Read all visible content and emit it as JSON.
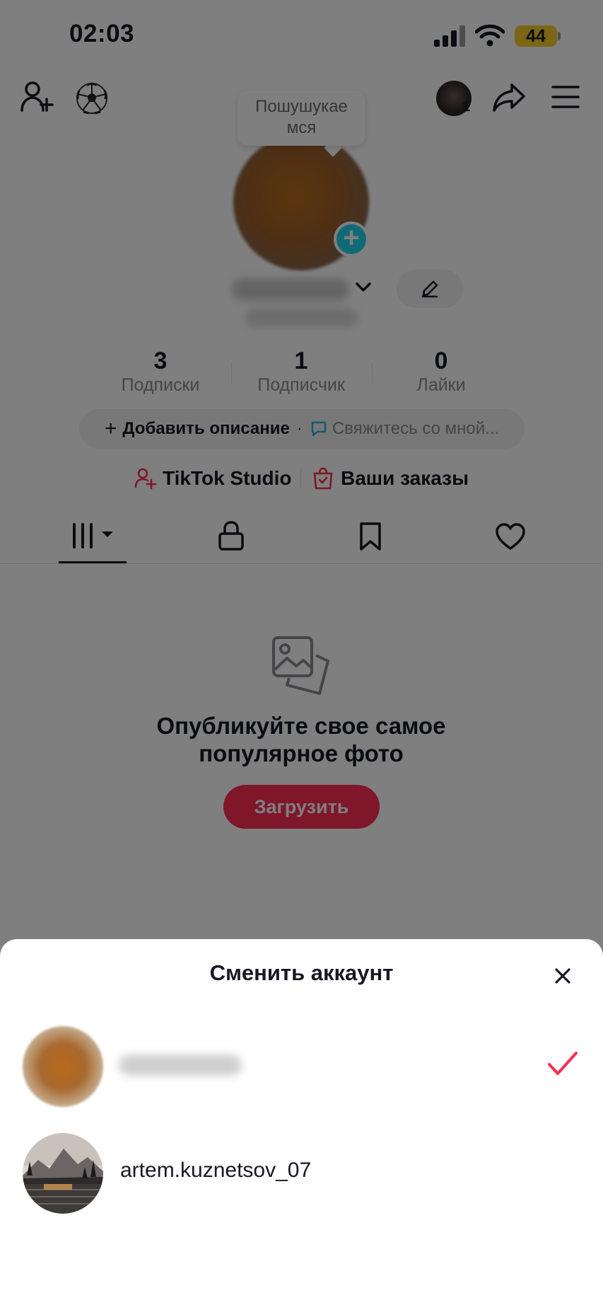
{
  "status_bar": {
    "time": "02:03",
    "battery": "44"
  },
  "header": {
    "avatar_badge": "1"
  },
  "profile": {
    "tooltip": "Пошушукаем ся",
    "tooltip_line1": "Пошушукае",
    "tooltip_line2": "мся",
    "stats": [
      {
        "value": "3",
        "label": "Подписки"
      },
      {
        "value": "1",
        "label": "Подписчик"
      },
      {
        "value": "0",
        "label": "Лайки"
      }
    ],
    "add_description": "Добавить описание",
    "bio_separator": "·",
    "contact_me": "Свяжитесь со мной...",
    "studio_label": "TikTok Studio",
    "orders_label": "Ваши заказы"
  },
  "empty_state": {
    "title_line1": "Опубликуйте свое самое",
    "title_line2": "популярное фото",
    "upload_button": "Загрузить"
  },
  "sheet": {
    "title": "Сменить аккаунт",
    "accounts": [
      {
        "name": "",
        "selected": true
      },
      {
        "name": "artem.kuznetsov_07",
        "selected": false
      }
    ]
  },
  "colors": {
    "accent": "#fe2c55",
    "plus_badge": "#20d5ec",
    "battery": "#f5cc28",
    "text": "#161823",
    "muted": "#8a8b91"
  },
  "icons": [
    "signal-icon",
    "wifi-icon",
    "add-friend-icon",
    "soccer-ball-icon",
    "share-icon",
    "menu-icon",
    "chevron-down-icon",
    "edit-pencil-icon",
    "chat-bubble-icon",
    "studio-person-icon",
    "orders-bag-icon",
    "grid-videos-icon",
    "lock-icon",
    "bookmark-icon",
    "heart-icon",
    "photo-stack-icon",
    "close-icon",
    "checkmark-icon"
  ]
}
